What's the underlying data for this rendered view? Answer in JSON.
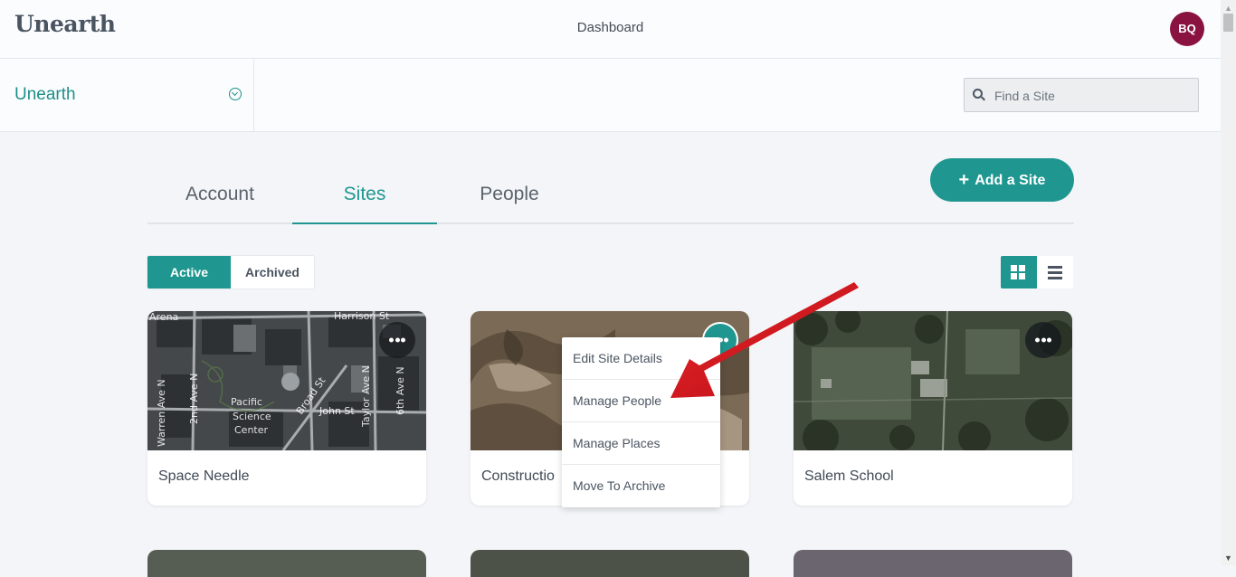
{
  "header": {
    "logo": "Unearth",
    "title": "Dashboard",
    "avatar_initials": "BQ"
  },
  "org": {
    "name": "Unearth"
  },
  "search": {
    "placeholder": "Find a Site"
  },
  "tabs": [
    {
      "label": "Account",
      "active": false
    },
    {
      "label": "Sites",
      "active": true
    },
    {
      "label": "People",
      "active": false
    }
  ],
  "add_site": {
    "label": "Add a Site"
  },
  "filter": {
    "active_label": "Active",
    "archived_label": "Archived",
    "selected": "Active"
  },
  "view": {
    "selected": "grid"
  },
  "sites": [
    {
      "name": "Space Needle",
      "map_labels": [
        "Harrison St",
        "Pacific",
        "Science",
        "Center",
        "Broad St",
        "John St",
        "Taylor Ave N",
        "6th Ave N",
        "2nd Ave N",
        "Warren Ave N",
        "Arena"
      ]
    },
    {
      "name": "Constructio"
    },
    {
      "name": "Salem School"
    }
  ],
  "site_menu": {
    "items": [
      "Edit Site Details",
      "Manage People",
      "Manage Places",
      "Move To Archive"
    ]
  },
  "colors": {
    "accent": "#1f9790",
    "avatar": "#8a1240",
    "arrow": "#d8121b"
  }
}
